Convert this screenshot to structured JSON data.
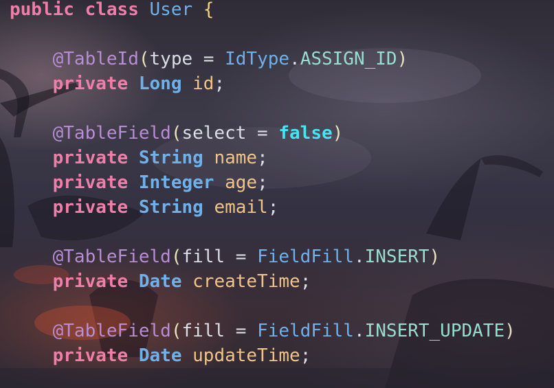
{
  "editor": {
    "language": "java",
    "lines": [
      [
        {
          "t": "public",
          "c": "kw"
        },
        {
          "t": " ",
          "c": "plain"
        },
        {
          "t": "class",
          "c": "kw"
        },
        {
          "t": " ",
          "c": "plain"
        },
        {
          "t": "User",
          "c": "cls"
        },
        {
          "t": " ",
          "c": "plain"
        },
        {
          "t": "{",
          "c": "brace"
        }
      ],
      [],
      [
        {
          "t": "    ",
          "c": "plain"
        },
        {
          "t": "@TableId",
          "c": "ann"
        },
        {
          "t": "(",
          "c": "paren"
        },
        {
          "t": "type",
          "c": "plain"
        },
        {
          "t": " = ",
          "c": "plain"
        },
        {
          "t": "IdType",
          "c": "ref"
        },
        {
          "t": ".",
          "c": "plain"
        },
        {
          "t": "ASSIGN_ID",
          "c": "const"
        },
        {
          "t": ")",
          "c": "paren"
        }
      ],
      [
        {
          "t": "    ",
          "c": "plain"
        },
        {
          "t": "private",
          "c": "kw"
        },
        {
          "t": " ",
          "c": "plain"
        },
        {
          "t": "Long",
          "c": "type"
        },
        {
          "t": " ",
          "c": "plain"
        },
        {
          "t": "id",
          "c": "var"
        },
        {
          "t": ";",
          "c": "plain"
        }
      ],
      [],
      [
        {
          "t": "    ",
          "c": "plain"
        },
        {
          "t": "@TableField",
          "c": "ann"
        },
        {
          "t": "(",
          "c": "paren"
        },
        {
          "t": "select",
          "c": "plain"
        },
        {
          "t": " = ",
          "c": "plain"
        },
        {
          "t": "false",
          "c": "bool"
        },
        {
          "t": ")",
          "c": "paren"
        }
      ],
      [
        {
          "t": "    ",
          "c": "plain"
        },
        {
          "t": "private",
          "c": "kw"
        },
        {
          "t": " ",
          "c": "plain"
        },
        {
          "t": "String",
          "c": "type"
        },
        {
          "t": " ",
          "c": "plain"
        },
        {
          "t": "name",
          "c": "var"
        },
        {
          "t": ";",
          "c": "plain"
        }
      ],
      [
        {
          "t": "    ",
          "c": "plain"
        },
        {
          "t": "private",
          "c": "kw"
        },
        {
          "t": " ",
          "c": "plain"
        },
        {
          "t": "Integer",
          "c": "type"
        },
        {
          "t": " ",
          "c": "plain"
        },
        {
          "t": "age",
          "c": "var"
        },
        {
          "t": ";",
          "c": "plain"
        }
      ],
      [
        {
          "t": "    ",
          "c": "plain"
        },
        {
          "t": "private",
          "c": "kw"
        },
        {
          "t": " ",
          "c": "plain"
        },
        {
          "t": "String",
          "c": "type"
        },
        {
          "t": " ",
          "c": "plain"
        },
        {
          "t": "email",
          "c": "var"
        },
        {
          "t": ";",
          "c": "plain"
        }
      ],
      [],
      [
        {
          "t": "    ",
          "c": "plain"
        },
        {
          "t": "@TableField",
          "c": "ann"
        },
        {
          "t": "(",
          "c": "paren"
        },
        {
          "t": "fill",
          "c": "plain"
        },
        {
          "t": " = ",
          "c": "plain"
        },
        {
          "t": "FieldFill",
          "c": "ref"
        },
        {
          "t": ".",
          "c": "plain"
        },
        {
          "t": "INSERT",
          "c": "const"
        },
        {
          "t": ")",
          "c": "paren"
        }
      ],
      [
        {
          "t": "    ",
          "c": "plain"
        },
        {
          "t": "private",
          "c": "kw"
        },
        {
          "t": " ",
          "c": "plain"
        },
        {
          "t": "Date",
          "c": "type"
        },
        {
          "t": " ",
          "c": "plain"
        },
        {
          "t": "createTime",
          "c": "var"
        },
        {
          "t": ";",
          "c": "plain"
        }
      ],
      [],
      [
        {
          "t": "    ",
          "c": "plain"
        },
        {
          "t": "@TableField",
          "c": "ann"
        },
        {
          "t": "(",
          "c": "paren"
        },
        {
          "t": "fill",
          "c": "plain"
        },
        {
          "t": " = ",
          "c": "plain"
        },
        {
          "t": "FieldFill",
          "c": "ref"
        },
        {
          "t": ".",
          "c": "plain"
        },
        {
          "t": "INSERT_UPDATE",
          "c": "const"
        },
        {
          "t": ")",
          "c": "paren"
        }
      ],
      [
        {
          "t": "    ",
          "c": "plain"
        },
        {
          "t": "private",
          "c": "kw"
        },
        {
          "t": " ",
          "c": "plain"
        },
        {
          "t": "Date",
          "c": "type"
        },
        {
          "t": " ",
          "c": "plain"
        },
        {
          "t": "updateTime",
          "c": "var"
        },
        {
          "t": ";",
          "c": "plain"
        }
      ]
    ]
  },
  "colors": {
    "keyword": "#ee7fa8",
    "type": "#6fb1ea",
    "annotation": "#b98dd6",
    "boolean": "#43e6f2",
    "field": "#f0c48a",
    "constant": "#99ddcf",
    "brace": "#f1d37a"
  }
}
